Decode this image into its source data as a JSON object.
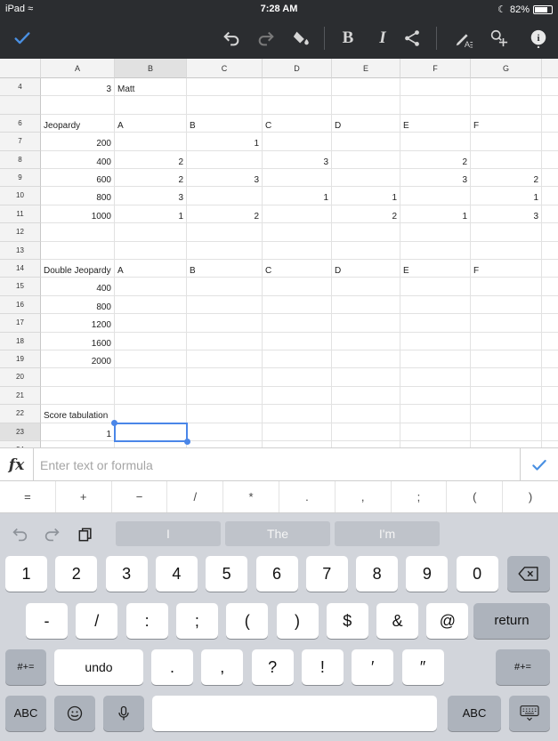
{
  "status_bar": {
    "device": "iPad",
    "time": "7:28 AM",
    "battery": "82%"
  },
  "toolbar": {
    "done_icon": "checkmark-icon",
    "tools": [
      "undo-icon",
      "redo-icon",
      "paint-format-icon",
      "bold-icon",
      "italic-icon",
      "share-icon",
      "text-format-icon",
      "insert-icon",
      "info-icon"
    ]
  },
  "grid": {
    "columns": [
      "A",
      "B",
      "C",
      "D",
      "E",
      "F",
      "G"
    ],
    "selected_column": "B",
    "selected_row": "23",
    "rows": [
      {
        "num": "4",
        "cells": [
          "3",
          "Matt",
          "",
          "",
          "",
          "",
          ""
        ]
      },
      {
        "num": "",
        "cells": [
          "",
          "",
          "",
          "",
          "",
          "",
          ""
        ]
      },
      {
        "num": "6",
        "cells": [
          "Jeopardy",
          "A",
          "B",
          "C",
          "D",
          "E",
          "F"
        ]
      },
      {
        "num": "7",
        "cells": [
          "200",
          "",
          "1",
          "",
          "",
          "",
          ""
        ]
      },
      {
        "num": "8",
        "cells": [
          "400",
          "2",
          "",
          "3",
          "",
          "2",
          ""
        ]
      },
      {
        "num": "9",
        "cells": [
          "600",
          "2",
          "3",
          "",
          "",
          "3",
          "2"
        ]
      },
      {
        "num": "10",
        "cells": [
          "800",
          "3",
          "",
          "1",
          "1",
          "",
          "1"
        ]
      },
      {
        "num": "11",
        "cells": [
          "1000",
          "1",
          "2",
          "",
          "2",
          "1",
          "3"
        ]
      },
      {
        "num": "12",
        "cells": [
          "",
          "",
          "",
          "",
          "",
          "",
          ""
        ]
      },
      {
        "num": "13",
        "cells": [
          "",
          "",
          "",
          "",
          "",
          "",
          ""
        ]
      },
      {
        "num": "14",
        "cells": [
          "Double Jeopardy",
          "A",
          "B",
          "C",
          "D",
          "E",
          "F"
        ]
      },
      {
        "num": "15",
        "cells": [
          "400",
          "",
          "",
          "",
          "",
          "",
          ""
        ]
      },
      {
        "num": "16",
        "cells": [
          "800",
          "",
          "",
          "",
          "",
          "",
          ""
        ]
      },
      {
        "num": "17",
        "cells": [
          "1200",
          "",
          "",
          "",
          "",
          "",
          ""
        ]
      },
      {
        "num": "18",
        "cells": [
          "1600",
          "",
          "",
          "",
          "",
          "",
          ""
        ]
      },
      {
        "num": "19",
        "cells": [
          "2000",
          "",
          "",
          "",
          "",
          "",
          ""
        ]
      },
      {
        "num": "20",
        "cells": [
          "",
          "",
          "",
          "",
          "",
          "",
          ""
        ]
      },
      {
        "num": "21",
        "cells": [
          "",
          "",
          "",
          "",
          "",
          "",
          ""
        ]
      },
      {
        "num": "22",
        "cells": [
          "Score tabulation",
          "",
          "",
          "",
          "",
          "",
          ""
        ]
      },
      {
        "num": "23",
        "cells": [
          "1",
          "",
          "",
          "",
          "",
          "",
          ""
        ]
      },
      {
        "num": "24",
        "cells": [
          "",
          "",
          "",
          "",
          "",
          "",
          ""
        ]
      }
    ]
  },
  "formula_bar": {
    "fx": "fx",
    "placeholder": "Enter text or formula",
    "value": ""
  },
  "operators": [
    "=",
    "+",
    "−",
    "/",
    "*",
    ".",
    ",",
    ";",
    "(",
    ")"
  ],
  "keyboard": {
    "suggestions": [
      "I",
      "The",
      "I'm"
    ],
    "row1": [
      "1",
      "2",
      "3",
      "4",
      "5",
      "6",
      "7",
      "8",
      "9",
      "0"
    ],
    "row2": [
      "-",
      "/",
      ":",
      ";",
      "(",
      ")",
      "$",
      "&",
      "@"
    ],
    "return_label": "return",
    "row3_left": "#+=",
    "undo_label": "undo",
    "row3": [
      ".",
      ",",
      "?",
      "!",
      "′",
      "″"
    ],
    "row3_right": "#+=",
    "abc_left": "ABC",
    "abc_right": "ABC"
  }
}
